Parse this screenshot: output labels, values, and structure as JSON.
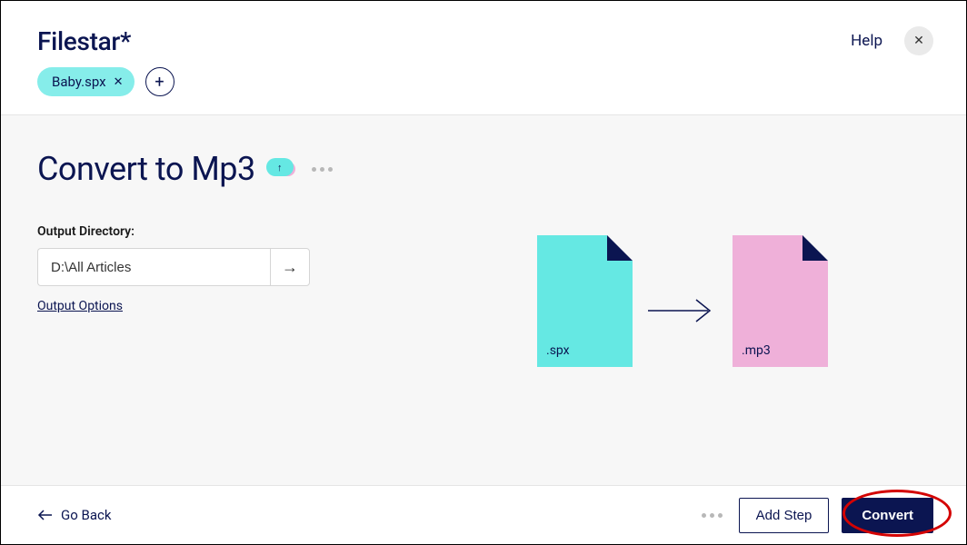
{
  "header": {
    "app_title": "Filestar*",
    "help_label": "Help",
    "close_glyph": "✕"
  },
  "file_chips": [
    {
      "label": "Baby.spx",
      "close_glyph": "✕"
    }
  ],
  "add_chip_glyph": "+",
  "page": {
    "title": "Convert to Mp3",
    "cloud_arrow_glyph": "↑"
  },
  "output": {
    "label": "Output Directory:",
    "path": "D:\\All Articles",
    "go_glyph": "→",
    "options_label": "Output Options"
  },
  "diagram": {
    "source_ext": ".spx",
    "target_ext": ".mp3"
  },
  "footer": {
    "go_back_label": "Go Back",
    "add_step_label": "Add Step",
    "convert_label": "Convert"
  }
}
